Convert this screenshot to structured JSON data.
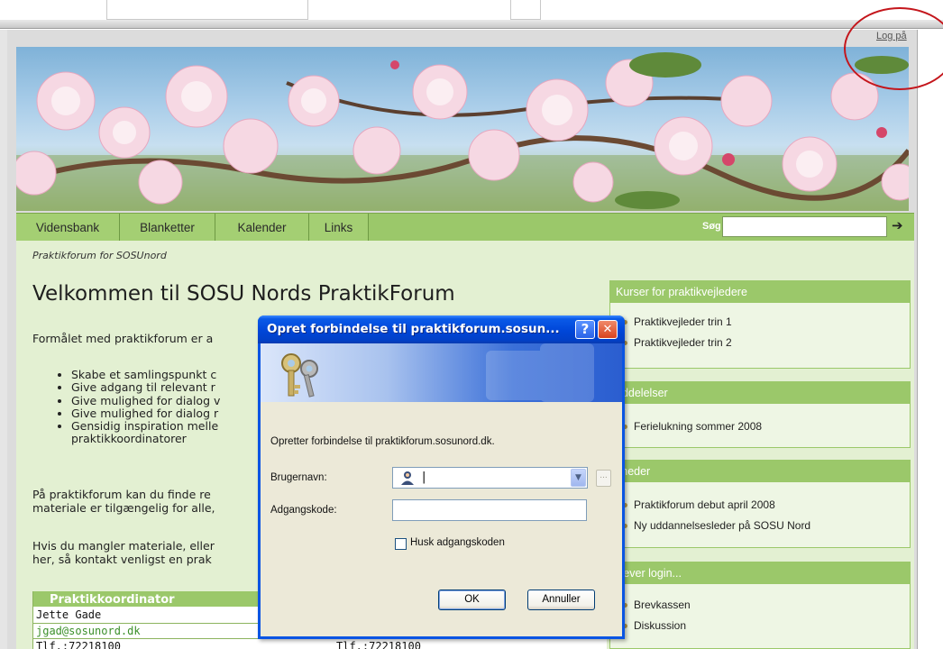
{
  "browser": {
    "login_link": "Log på"
  },
  "nav": {
    "items": [
      "Vidensbank",
      "Blanketter",
      "Kalender",
      "Links"
    ],
    "search_label": "Søg",
    "search_value": "",
    "search_go": "➔"
  },
  "main": {
    "breadcrumb": "Praktikforum for SOSUnord",
    "title": "Velkommen til SOSU Nords PraktikForum",
    "intro": "Formålet med praktikforum er a",
    "bullets": [
      "Skabe et samlingspunkt c",
      "Give adgang til relevant r",
      "Give mulighed for dialog v",
      "Give mulighed for dialog r",
      "Gensidig inspiration melle",
      "praktikkoordinatorer"
    ],
    "para1": [
      "På praktikforum kan du finde re",
      "materiale er tilgængelig for alle,"
    ],
    "para2": [
      "Hvis du mangler materiale, eller",
      "her, så kontakt venligst en prak"
    ],
    "coordinator": {
      "header": "Praktikkoordinator",
      "left": [
        "Jette Gade",
        "jgad@sosunord.dk",
        "Tlf.:72218100"
      ],
      "right": [
        "Tlf.:72218100"
      ]
    }
  },
  "sidebar": {
    "boxes": [
      {
        "title": "Kurser for praktikvejledere",
        "items": [
          "Praktikvejleder trin 1",
          "Praktikvejleder trin 2"
        ]
      },
      {
        "title": "eddelelser",
        "items": [
          "Ferielukning sommer 2008"
        ]
      },
      {
        "title": "yheder",
        "items": [
          "Praktikforum debut april 2008",
          "Ny uddannelsesleder på SOSU Nord"
        ]
      },
      {
        "title": "ræver login...",
        "items": [
          "Brevkassen",
          "Diskussion"
        ]
      }
    ]
  },
  "dialog": {
    "title": "Opret forbindelse til praktikforum.sosun...",
    "help_button": "?",
    "close_button": "✕",
    "message": "Opretter forbindelse til praktikforum.sosunord.dk.",
    "username_label": "Brugernavn:",
    "username_value": "|",
    "password_label": "Adgangskode:",
    "password_value": "",
    "remember_label": "Husk adgangskoden",
    "remember_checked": false,
    "ok_label": "OK",
    "cancel_label": "Annuller",
    "more_button": "...",
    "combo_arrow": "▼"
  },
  "colors": {
    "nav_green": "#9bc86a",
    "content_green": "#e3f0d2",
    "xp_blue": "#0a54e3",
    "close_red": "#e04a2a",
    "annotation_red": "#c4161c"
  },
  "icons": {
    "user": "user-icon",
    "keys": "keys-icon",
    "search_go": "arrow-right-icon"
  }
}
